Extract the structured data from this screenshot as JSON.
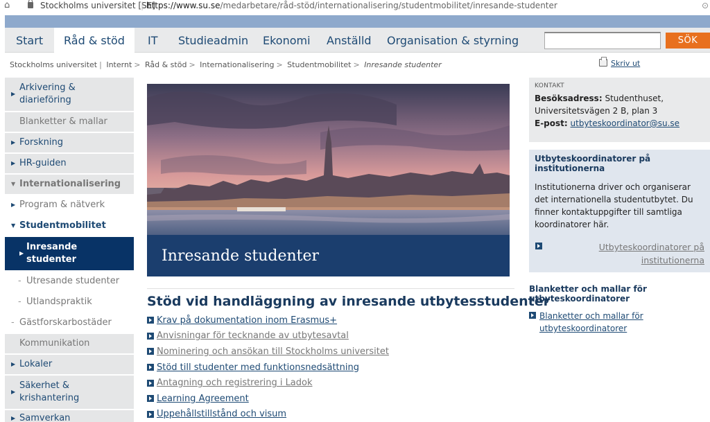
{
  "browser": {
    "site_name": "Stockholms universitet [SE]",
    "url_host": "https://www.su.se",
    "url_path": "/medarbetare/råd-stöd/internationalisering/studentmobilitet/inresande-studenter"
  },
  "nav": {
    "items": [
      {
        "label": "Start"
      },
      {
        "label": "Råd & stöd"
      },
      {
        "label": "IT"
      },
      {
        "label": "Studieadmin"
      },
      {
        "label": "Ekonomi"
      },
      {
        "label": "Anställd"
      },
      {
        "label": "Organisation & styrning"
      }
    ],
    "search_button": "SÖK",
    "search_value": ""
  },
  "breadcrumb": {
    "items": [
      "Stockholms universitet",
      "Internt",
      "Råd & stöd",
      "Internationalisering",
      "Studentmobilitet"
    ],
    "current": "Inresande studenter",
    "print_label": "Skriv ut"
  },
  "sidebar": {
    "items": [
      {
        "label": "Arkivering & diarieföring"
      },
      {
        "label": "Blanketter & mallar"
      },
      {
        "label": "Forskning"
      },
      {
        "label": "HR-guiden"
      },
      {
        "label": "Internationalisering"
      },
      {
        "label": "Program & nätverk"
      },
      {
        "label": "Studentmobilitet"
      },
      {
        "label": "Inresande studenter"
      },
      {
        "label": "Utresande studenter"
      },
      {
        "label": "Utlandspraktik"
      },
      {
        "label": "Gästforskarbostäder"
      },
      {
        "label": "Kommunikation"
      },
      {
        "label": "Lokaler"
      },
      {
        "label": "Säkerhet & krishantering"
      },
      {
        "label": "Samverkan"
      }
    ]
  },
  "hero": {
    "caption": "Inresande studenter"
  },
  "main": {
    "heading": "Stöd vid handläggning av inresande utbytesstudenter",
    "links": [
      "Krav på dokumentation inom Erasmus+",
      "Anvisningar för tecknande av utbytesavtal",
      "Nominering och ansökan till Stockholms universitet",
      "Stöd till studenter med funktionsnedsättning",
      "Antagning och registrering i Ladok",
      "Learning Agreement",
      "Uppehållstillstånd och visum"
    ]
  },
  "contact": {
    "label": "KONTAKT",
    "address_label": "Besöksadress:",
    "address": "Studenthuset, Universitetsvägen 2 B, plan 3",
    "email_label": "E-post:",
    "email": "utbyteskoordinator@su.se"
  },
  "coordinators": {
    "heading": "Utbyteskoordinatorer på institutionerna",
    "text": "Institutionerna driver och organiserar det internationella studentutbytet. Du finner kontaktuppgifter till samtliga koordinatorer här.",
    "link": "Utbyteskoordinatorer på institutionerna"
  },
  "forms": {
    "heading": "Blanketter och mallar för utbyteskoordinatorer",
    "link": "Blanketter och mallar för utbyteskoordinatorer"
  },
  "colors": {
    "nav_text": "#1e4a74",
    "band": "#8ea9cc",
    "search_button": "#e8701e",
    "selected": "#083366",
    "hero_caption_bg": "#1b3e6e"
  }
}
